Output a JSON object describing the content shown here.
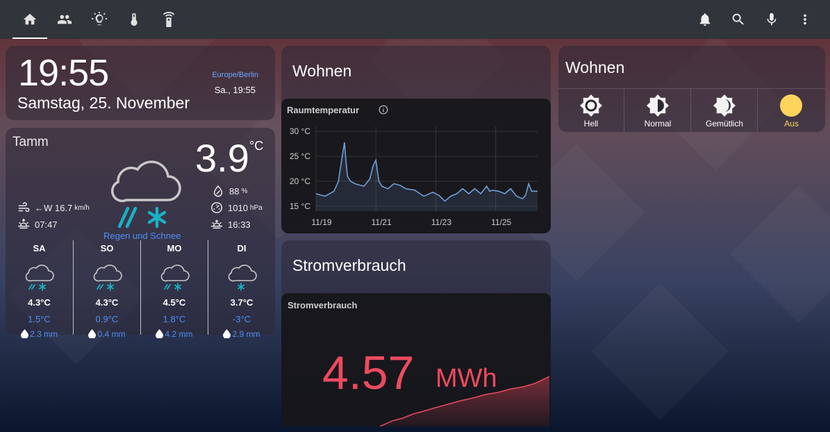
{
  "colors": {
    "topbar": "#30343b",
    "accent_blue": "#4f8ff5",
    "energy_red": "#ec4a5e",
    "temp_line": "#6f9fd8",
    "sun_yellow": "#ffd45c"
  },
  "topbar": {
    "tabs": [
      {
        "icon": "home-icon",
        "active": true
      },
      {
        "icon": "people-icon",
        "active": false
      },
      {
        "icon": "lightbulb-icon",
        "active": false
      },
      {
        "icon": "thermometer-icon",
        "active": false
      },
      {
        "icon": "remote-icon",
        "active": false
      }
    ],
    "actions": [
      "bell-icon",
      "search-icon",
      "microphone-icon",
      "more-vertical-icon"
    ]
  },
  "clock": {
    "time": "19:55",
    "date": "Samstag, 25. November",
    "timezone": "Europe/Berlin",
    "local_time": "Sa., 19:55"
  },
  "weather": {
    "location": "Tamm",
    "temperature": "3.9",
    "unit": "°C",
    "humidity": "88",
    "humidity_unit": "%",
    "pressure": "1010",
    "pressure_unit": "hPa",
    "wind": "←W 16.7",
    "wind_unit": "km/h",
    "sunrise": "07:47",
    "sunset": "16:33",
    "condition": "Regen und Schnee",
    "forecast": [
      {
        "day": "SA",
        "high": "4.3°C",
        "low": "1.5°C",
        "precip": "2.3 mm",
        "icon": "rain-snow-icon"
      },
      {
        "day": "SO",
        "high": "4.3°C",
        "low": "0.9°C",
        "precip": "0.4 mm",
        "icon": "rain-snow-icon"
      },
      {
        "day": "MO",
        "high": "4.5°C",
        "low": "1.8°C",
        "precip": "4.2 mm",
        "icon": "rain-snow-icon"
      },
      {
        "day": "DI",
        "high": "3.7°C",
        "low": "-3°C",
        "precip": "2.9 mm",
        "icon": "snow-icon"
      }
    ]
  },
  "wohnen_chart": {
    "card_title": "Wohnen",
    "chart_title": "Raumtemperatur"
  },
  "strom": {
    "card_title": "Stromverbrauch",
    "chart_title": "Stromverbrauch",
    "value": "4.57",
    "unit": "MWh"
  },
  "scenes": {
    "title": "Wohnen",
    "items": [
      {
        "label": "Hell",
        "icon": "brightness-high-icon",
        "active": false
      },
      {
        "label": "Normal",
        "icon": "brightness-medium-icon",
        "active": false
      },
      {
        "label": "Gemütlich",
        "icon": "brightness-low-icon",
        "active": false
      },
      {
        "label": "Aus",
        "icon": "sun-off-icon",
        "active": true
      }
    ]
  },
  "chart_data": {
    "type": "line",
    "title": "Raumtemperatur",
    "xlabel": "",
    "ylabel": "",
    "x_ticks": [
      "11/19",
      "11/21",
      "11/23",
      "11/25"
    ],
    "y_ticks": [
      "15 °C",
      "20 °C",
      "25 °C",
      "30 °C"
    ],
    "ylim": [
      14,
      31
    ],
    "xlim": [
      0,
      7.4
    ],
    "grid": true,
    "series": [
      {
        "x": [
          0,
          0.3,
          0.6,
          0.75,
          0.85,
          0.95,
          1.0,
          1.05,
          1.15,
          1.3,
          1.6,
          1.8,
          1.9,
          2.0,
          2.05,
          2.1,
          2.2,
          2.4,
          2.6,
          2.8,
          3.0,
          3.3,
          3.6,
          3.9,
          4.1,
          4.3,
          4.5,
          4.7,
          4.9,
          5.1,
          5.3,
          5.5,
          5.7,
          5.8,
          5.9,
          6.1,
          6.3,
          6.5,
          6.7,
          6.9,
          7.0,
          7.1,
          7.2,
          7.4
        ],
        "values": [
          17.5,
          17.0,
          18.0,
          20.0,
          24.0,
          27.8,
          24.0,
          21.0,
          20.0,
          19.5,
          19.0,
          20.5,
          23.0,
          24.2,
          22.0,
          20.0,
          19.0,
          18.5,
          19.5,
          19.2,
          18.5,
          18.2,
          17.0,
          17.8,
          17.2,
          16.0,
          17.0,
          17.5,
          18.5,
          17.5,
          18.5,
          17.5,
          19.0,
          18.0,
          18.2,
          18.0,
          17.5,
          18.5,
          17.0,
          16.5,
          17.2,
          19.5,
          18.0,
          18.0
        ]
      }
    ]
  }
}
